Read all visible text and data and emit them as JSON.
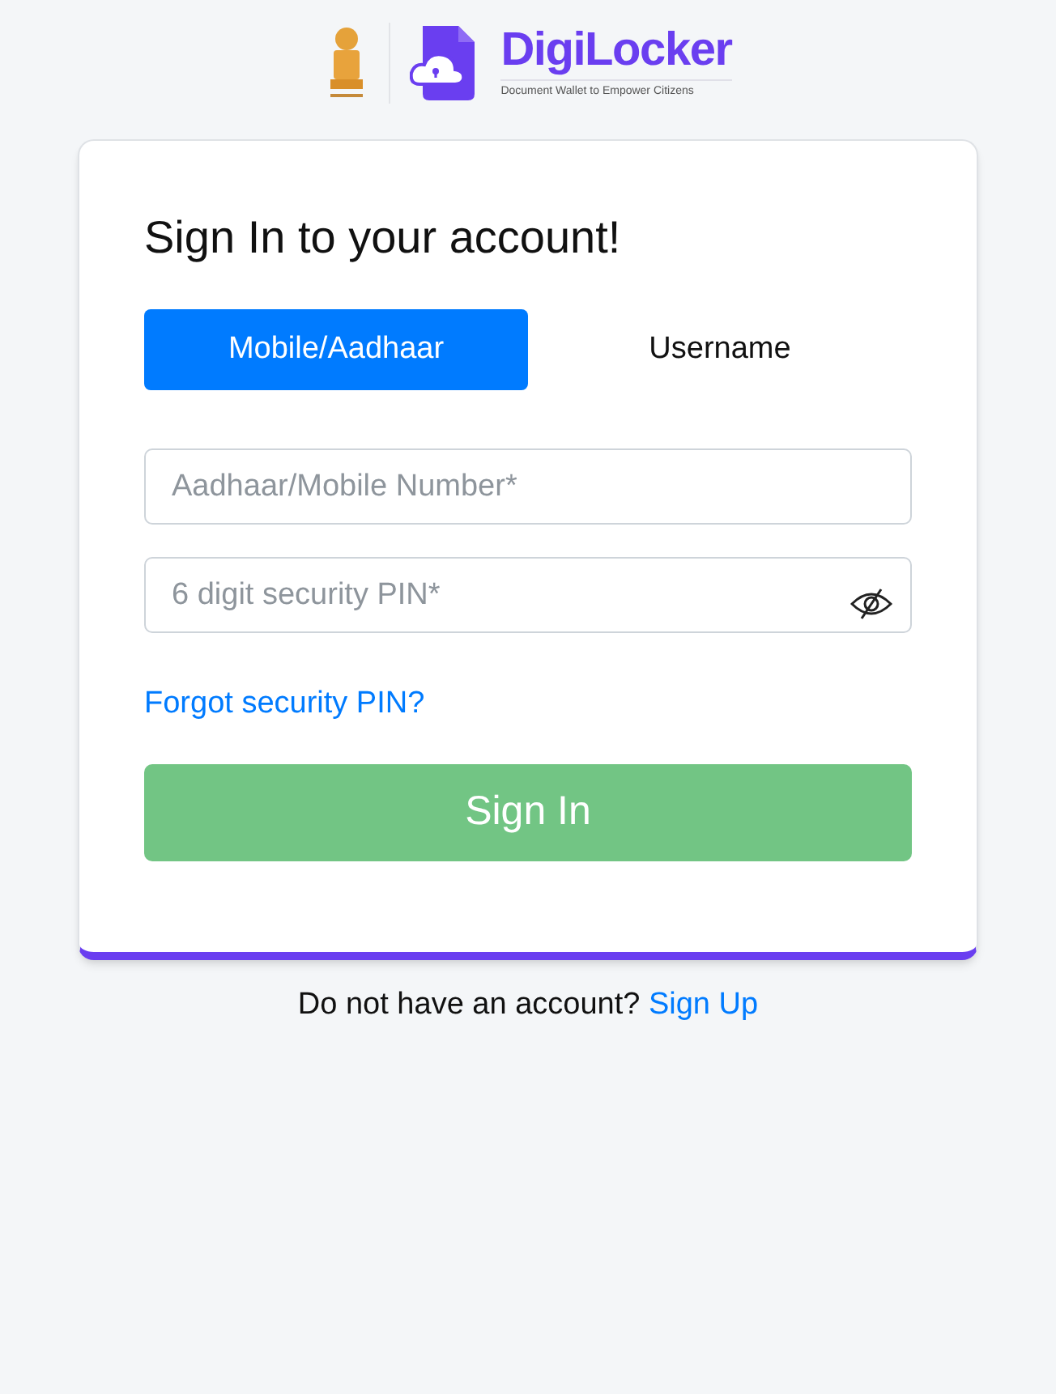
{
  "header": {
    "brand": "DigiLocker",
    "tagline": "Document Wallet to Empower Citizens"
  },
  "card": {
    "title": "Sign In to your account!",
    "tabs": [
      {
        "label": "Mobile/Aadhaar",
        "selected": true
      },
      {
        "label": "Username",
        "selected": false
      }
    ],
    "fields": [
      {
        "placeholder": "Aadhaar/Mobile Number*",
        "kind": "text"
      },
      {
        "placeholder": "6 digit security PIN*",
        "kind": "password"
      }
    ],
    "forgot_link": "Forgot security PIN?",
    "submit": {
      "label": "Sign In",
      "disabled": true
    }
  },
  "footer": {
    "text": "Do not have an account?",
    "link": "Sign Up"
  }
}
